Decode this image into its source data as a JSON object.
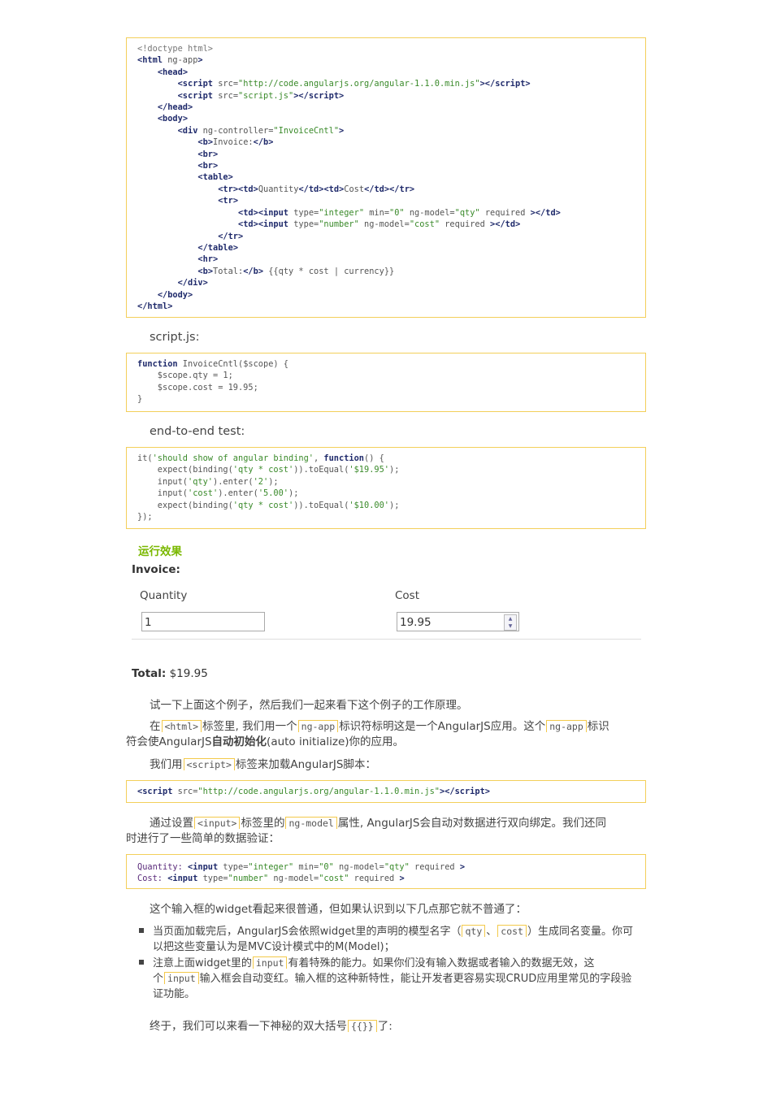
{
  "code_blocks": {
    "index_html": [
      "<!doctype html>",
      "<html ng-app>",
      "    <head>",
      "        <script src=\"http://code.angularjs.org/angular-1.1.0.min.js\"></script>",
      "        <script src=\"script.js\"></script>",
      "    </head>",
      "    <body>",
      "        <div ng-controller=\"InvoiceCntl\">",
      "            <b>Invoice:</b>",
      "            <br>",
      "            <br>",
      "            <table>",
      "                <tr><td>Quantity</td><td>Cost</td></tr>",
      "                <tr>",
      "                    <td><input type=\"integer\" min=\"0\" ng-model=\"qty\" required ></td>",
      "                    <td><input type=\"number\" ng-model=\"cost\" required ></td>",
      "                </tr>",
      "            </table>",
      "            <hr>",
      "            <b>Total:</b> {{qty * cost | currency}}",
      "        </div>",
      "    </body>",
      "</html>"
    ],
    "script_js": [
      "function InvoiceCntl($scope) {",
      "    $scope.qty = 1;",
      "    $scope.cost = 19.95;",
      "}"
    ],
    "e2e_test": [
      "it('should show of angular binding', function() {",
      "    expect(binding('qty * cost')).toEqual('$19.95');",
      "    input('qty').enter('2');",
      "    input('cost').enter('5.00');",
      "    expect(binding('qty * cost')).toEqual('$10.00');",
      "});"
    ],
    "script_tag": [
      "<script src=\"http://code.angularjs.org/angular-1.1.0.min.js\"></script>"
    ],
    "inputs": [
      "Quantity: <input type=\"integer\" min=\"0\" ng-model=\"qty\" required >",
      "Cost: <input type=\"number\" ng-model=\"cost\" required >"
    ]
  },
  "labels": {
    "script_js": "script.js:",
    "e2e": "end-to-end test:",
    "result_heading": "运行效果"
  },
  "demo": {
    "title": "Invoice:",
    "quantity_label": "Quantity",
    "cost_label": "Cost",
    "quantity_value": "1",
    "cost_value": "19.95",
    "spin_up": "▲",
    "spin_down": "▼",
    "total_label": "Total:",
    "total_value": "$19.95"
  },
  "text": {
    "p1": "试一下上面这个例子，然后我们一起来看下这个例子的工作原理。",
    "p2_a": "在",
    "p2_code1": "<html>",
    "p2_b": "标签里, 我们用一个",
    "p2_code2": "ng-app",
    "p2_c": "标识符标明这是一个AngularJS应用。这个",
    "p2_code3": "ng-app",
    "p2_d": "标识",
    "p2_e": "符会使AngularJS",
    "p2_bold": "自动初始化",
    "p2_f": "(auto initialize)你的应用。",
    "p3_a": "我们用",
    "p3_code": "<script>",
    "p3_b": "标签来加载AngularJS脚本：",
    "p4_a": "通过设置",
    "p4_code1": "<input>",
    "p4_b": "标签里的",
    "p4_code2": "ng-model",
    "p4_c": "属性, AngularJS会自动对数据进行双向绑定。我们还同",
    "p4_d": "时进行了一些简单的数据验证：",
    "p5": "这个输入框的widget看起来很普通，但如果认识到以下几点那它就不普通了：",
    "b1_a": "当页面加载完后，AngularJS会依照widget里的声明的模型名字（",
    "b1_code1": "qty",
    "b1_sep": "、",
    "b1_code2": "cost",
    "b1_b": "）生成同名变量。你可",
    "b1_c": "以把这些变量认为是MVC设计模式中的M(Model)；",
    "b2_a": "注意上面widget里的",
    "b2_code1": "input",
    "b2_b": "有着特殊的能力。如果你们没有输入数据或者输入的数据无效，这",
    "b2_c": "个",
    "b2_code2": "input",
    "b2_d": "输入框会自动变红。输入框的这种新特性，能让开发者更容易实现CRUD应用里常见的字段验",
    "b2_e": "证功能。",
    "p6_a": "终于，我们可以来看一下神秘的双大括号",
    "p6_code": "{{}}",
    "p6_b": "了:"
  }
}
